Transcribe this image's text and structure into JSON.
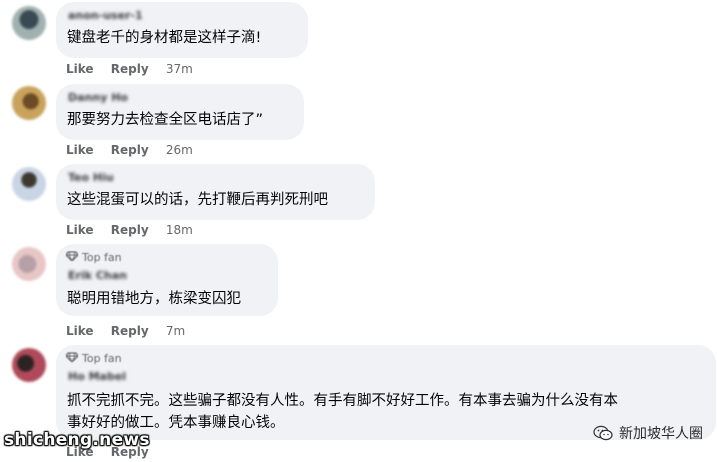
{
  "comments": [
    {
      "author": "anon-user-1",
      "badge": "",
      "text": "键盘老千的身材都是这样子滴!",
      "like": "Like",
      "reply": "Reply",
      "time": "37m",
      "avatar_colors": [
        "#9fb2b0",
        "#3b4a52"
      ]
    },
    {
      "author": "Danny Ho",
      "badge": "",
      "text": "那要努力去检查全区电话店了”",
      "like": "Like",
      "reply": "Reply",
      "time": "26m",
      "avatar_colors": [
        "#c9a35c",
        "#6b4a25"
      ]
    },
    {
      "author": "Teo Hiu",
      "badge": "",
      "text": "这些混蛋可以的话，先打鞭后再判死刑吧",
      "like": "Like",
      "reply": "Reply",
      "time": "18m",
      "avatar_colors": [
        "#c9d5e4",
        "#3d3730"
      ]
    },
    {
      "author": "Erik Chan",
      "badge": "Top fan",
      "text": "聪明用错地方，栋梁变囚犯",
      "like": "Like",
      "reply": "Reply",
      "time": "7m",
      "avatar_colors": [
        "#e7c7c5",
        "#b7a0a8"
      ]
    },
    {
      "author": "Ho Mabel",
      "badge": "Top fan",
      "text_lines": [
        "抓不完抓不完。这些骗子都没有人性。有手有脚不好好工作。有本事去骗为什么没有本",
        "事好好的做工。凭本事赚良心钱。"
      ],
      "like": "Like",
      "reply": "Reply",
      "time": "",
      "avatar_colors": [
        "#b04a5a",
        "#2c2422"
      ]
    }
  ],
  "watermark": {
    "site": "shicheng.news",
    "account": "新加坡华人圈"
  }
}
